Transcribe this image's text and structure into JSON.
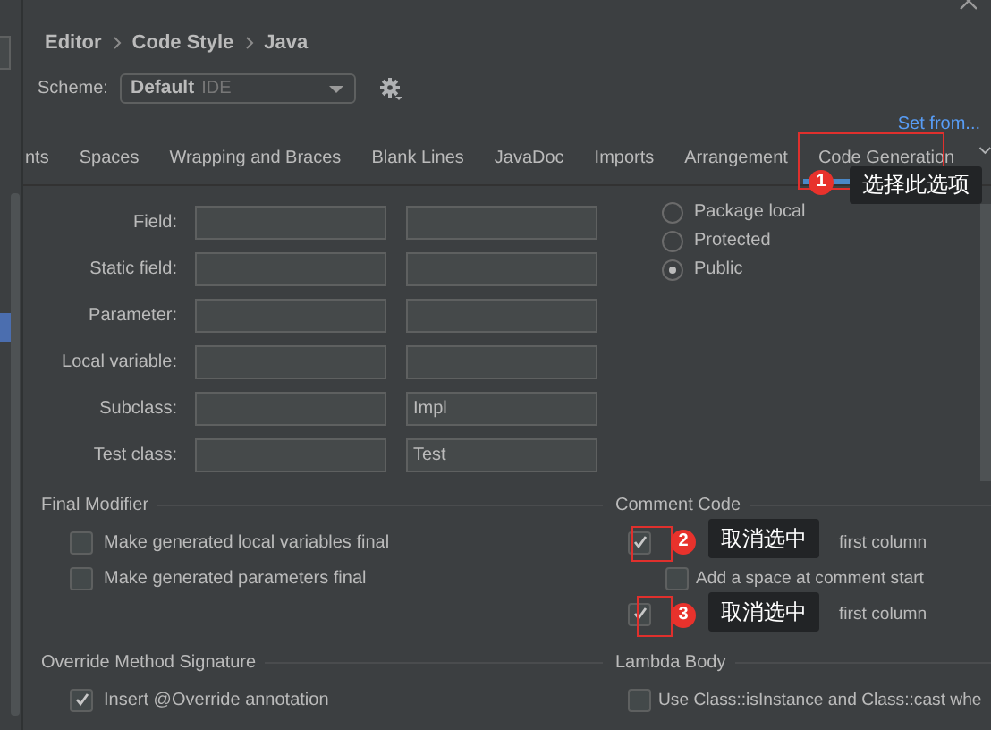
{
  "breadcrumb": [
    "Editor",
    "Code Style",
    "Java"
  ],
  "scheme": {
    "label": "Scheme:",
    "value": "Default",
    "tag": "IDE"
  },
  "set_from_link": "Set from...",
  "tabs": [
    {
      "label": "nts",
      "selected": false
    },
    {
      "label": "Spaces",
      "selected": false
    },
    {
      "label": "Wrapping and Braces",
      "selected": false
    },
    {
      "label": "Blank Lines",
      "selected": false
    },
    {
      "label": "JavaDoc",
      "selected": false
    },
    {
      "label": "Imports",
      "selected": false
    },
    {
      "label": "Arrangement",
      "selected": false
    },
    {
      "label": "Code Generation",
      "selected": true
    }
  ],
  "naming_rows": [
    {
      "label": "Field:"
    },
    {
      "label": "Static field:"
    },
    {
      "label": "Parameter:"
    },
    {
      "label": "Local variable:"
    },
    {
      "label": "Subclass:",
      "suffix": "Impl"
    },
    {
      "label": "Test class:",
      "suffix": "Test"
    }
  ],
  "visibility_options": [
    {
      "label": "Package local",
      "selected": false
    },
    {
      "label": "Protected",
      "selected": false
    },
    {
      "label": "Public",
      "selected": true
    }
  ],
  "final_modifier": {
    "title": "Final Modifier",
    "options": [
      {
        "label": "Make generated local variables final",
        "checked": false
      },
      {
        "label": "Make generated parameters final",
        "checked": false
      }
    ]
  },
  "comment_code": {
    "title": "Comment Code",
    "options": [
      {
        "label": "first column",
        "checked": true,
        "children": [
          {
            "label": "Add a space at comment start",
            "checked": false
          }
        ]
      },
      {
        "label": "first column",
        "checked": true
      }
    ]
  },
  "override_method_signature": {
    "title": "Override Method Signature",
    "options": [
      {
        "label": "Insert @Override annotation",
        "checked": true
      }
    ]
  },
  "lambda_body": {
    "title": "Lambda Body",
    "options": [
      {
        "label": "Use Class::isInstance and Class::cast whe",
        "checked": false
      }
    ]
  },
  "annotations": [
    {
      "number": "1",
      "text": "选择此选项"
    },
    {
      "number": "2",
      "text": "取消选中"
    },
    {
      "number": "3",
      "text": "取消选中"
    }
  ]
}
